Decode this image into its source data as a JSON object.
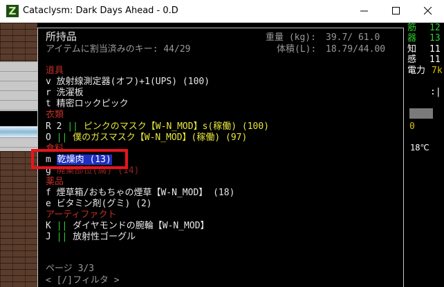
{
  "window": {
    "title": "Cataclysm: Dark Days Ahead - 0.D",
    "icon_letter": "Z"
  },
  "inventory": {
    "title": "所持品",
    "assigned_keys": "アイテムに割当済みのキー: 44/29",
    "weight_label": "重量 (kg):",
    "weight_value": "39.7/ 61.0",
    "volume_label": "体積(L):",
    "volume_value": "18.79/44.00",
    "categories": {
      "tools": "道具",
      "clothing": "衣類",
      "food": "食料",
      "drugs": "薬品",
      "artifacts": "アーティファクト"
    },
    "items": {
      "v": {
        "key": "v",
        "name": "放射線測定器(オフ)+1(UPS) (100)"
      },
      "r": {
        "key": "r",
        "name": "洗濯板"
      },
      "t": {
        "key": "t",
        "name": "精密ロックピック"
      },
      "R": {
        "key": "R",
        "count": "2",
        "sep": "||",
        "name": "ピンクのマスク【W-N_MOD】s(稼働) (100)"
      },
      "O": {
        "key": "O",
        "sep": "||",
        "name": "僕のガスマスク【W-N_MOD】(稼働) (97)"
      },
      "m": {
        "key": "m",
        "name": "乾燥肉 (13)"
      },
      "g": {
        "key": "g",
        "name": "廃棄部位(腐) (14)"
      },
      "f": {
        "key": "f",
        "name": "煙草箱/おもちゃの煙草【W-N_MOD】 (18)"
      },
      "e": {
        "key": "e",
        "name": "ビタミン剤(グミ) (2)"
      },
      "K": {
        "key": "K",
        "sep": "||",
        "name": "ダイヤモンドの腕輪【W-N_MOD】"
      },
      "J": {
        "key": "J",
        "sep": "||",
        "name": "放射性ゴーグル"
      }
    },
    "page": "ページ 3/3",
    "filter": "< [/]フィルタ >"
  },
  "sidebar": {
    "str_label": "筋",
    "str_value": "12",
    "dex_label": "器",
    "dex_value": "13",
    "int_label": "知",
    "int_value": "11",
    "per_label": "感",
    "per_value": "11",
    "power_label": "電力",
    "power_value": "7k",
    "colon": ":|",
    "zero": "0",
    "temp": "18℃"
  },
  "colors": {
    "category_red": "#c03028",
    "selection_blue": "#1f2fbf",
    "annotation_red": "#e8141c",
    "worn_green": "#2fcf2f",
    "worn_yellow": "#e8e83c"
  }
}
